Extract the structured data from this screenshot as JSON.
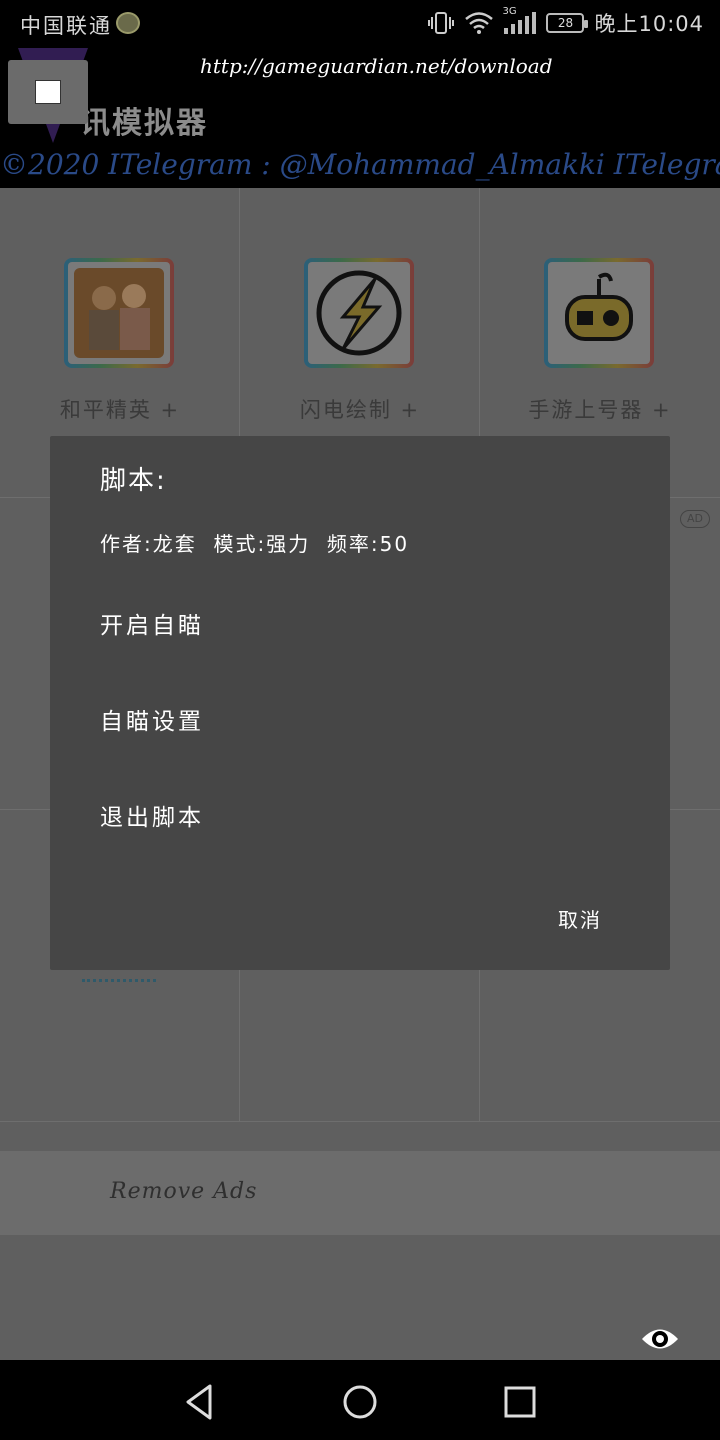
{
  "status_bar": {
    "carrier": "中国联通",
    "network": "3G",
    "battery": "28",
    "time": "晚上10:04"
  },
  "header": {
    "url": "http://gameguardian.net/download",
    "app_title": "讯模拟器",
    "marquee": "©2020 ITelegram : @Mohammad_Almakki ITelegram : ··"
  },
  "apps": [
    {
      "label": "和平精英 +",
      "icon": "game-soldiers-icon"
    },
    {
      "label": "闪电绘制 +",
      "icon": "lightning-bolt-icon"
    },
    {
      "label": "手游上号器 +",
      "icon": "gamepad-robot-icon"
    }
  ],
  "ad_badge": "AD",
  "remove_ads": "Remove Ads",
  "dialog": {
    "title": "脚本:",
    "info": "作者:龙套  模式:强力  频率:50",
    "items": [
      "开启自瞄",
      "自瞄设置",
      "退出脚本"
    ],
    "cancel": "取消"
  },
  "colors": {
    "dialog_bg": "#464646",
    "dimmed_bg": "#5f5f5f",
    "marquee": "#2a4a88"
  }
}
